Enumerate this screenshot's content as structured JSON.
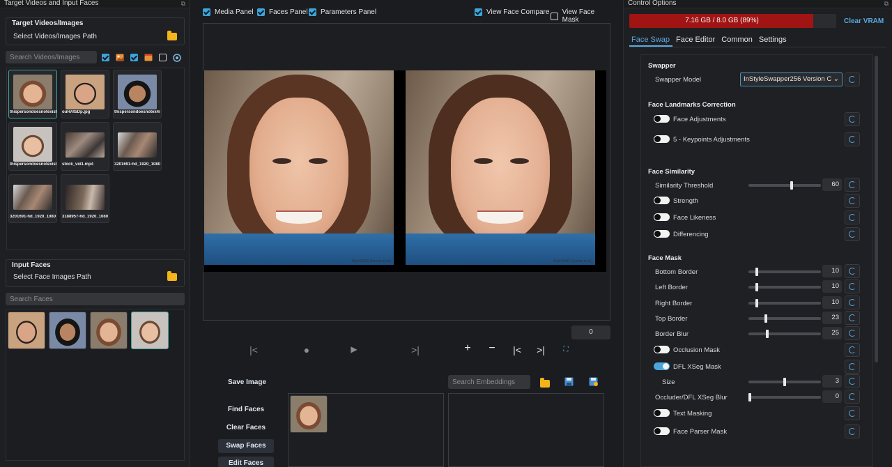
{
  "left_panel": {
    "title": "Target Videos and Input Faces",
    "target_group_title": "Target Videos/Images",
    "target_path_label": "Select Videos/Images Path",
    "search_videos_placeholder": "Search Videos/Images",
    "thumbnails": [
      {
        "caption": "thispersondoesnotexist",
        "kind": "face"
      },
      {
        "caption": "ouHAtbDp.jpg",
        "kind": "face"
      },
      {
        "caption": "thispersondoesnotex4i",
        "kind": "face"
      },
      {
        "caption": "thispersondoesnotexist",
        "kind": "face"
      },
      {
        "caption": "stock_vid1.mp4",
        "kind": "video"
      },
      {
        "caption": "3201691-hd_1920_1080",
        "kind": "video"
      },
      {
        "caption": "3201691-hd_1920_1080",
        "kind": "video"
      },
      {
        "caption": "3188957-hd_1920_1080",
        "kind": "video"
      }
    ],
    "input_faces_title": "Input Faces",
    "face_path_label": "Select Face Images Path",
    "search_faces_placeholder": "Search Faces"
  },
  "center": {
    "toggles": [
      {
        "label": "Media Panel",
        "checked": true
      },
      {
        "label": "Faces Panel",
        "checked": true
      },
      {
        "label": "Parameters Panel",
        "checked": true
      },
      {
        "label": "View Face Compare",
        "checked": true
      },
      {
        "label": "View Face Mask",
        "checked": false
      }
    ],
    "watermark": "StyleGAN2 (Karras et al.)",
    "frame_number": "0",
    "save_image_label": "Save Image",
    "search_embeddings_placeholder": "Search Embeddings",
    "buttons": {
      "find": "Find Faces",
      "clear": "Clear Faces",
      "swap": "Swap Faces",
      "edit": "Edit Faces"
    }
  },
  "right_panel": {
    "title": "Control Options",
    "vram_text": "7.16 GB / 8.0 GB (89%)",
    "vram_fraction": 0.89,
    "clear_vram": "Clear VRAM",
    "tabs": [
      "Face Swap",
      "Face Editor",
      "Common",
      "Settings"
    ],
    "active_tab": "Face Swap",
    "sections": {
      "swapper": "Swapper",
      "landmarks": "Face Landmarks Correction",
      "similarity": "Face Similarity",
      "mask": "Face Mask"
    },
    "swapper_model_label": "Swapper Model",
    "swapper_model_value": "InStyleSwapper256 Version C",
    "face_adjustments": "Face Adjustments",
    "keypoints_adjustments": "5 - Keypoints Adjustments",
    "similarity_threshold": {
      "label": "Similarity Threshold",
      "value": "60",
      "fraction": 0.6
    },
    "strength": "Strength",
    "face_likeness": "Face Likeness",
    "differencing": "Differencing",
    "bottom_border": {
      "label": "Bottom Border",
      "value": "10",
      "fraction": 0.1
    },
    "left_border": {
      "label": "Left Border",
      "value": "10",
      "fraction": 0.1
    },
    "right_border": {
      "label": "Right Border",
      "value": "10",
      "fraction": 0.1
    },
    "top_border": {
      "label": "Top Border",
      "value": "23",
      "fraction": 0.23
    },
    "border_blur": {
      "label": "Border Blur",
      "value": "25",
      "fraction": 0.25
    },
    "occlusion_mask": "Occlusion Mask",
    "dfl_xseg_mask": "DFL XSeg Mask",
    "size": {
      "label": "Size",
      "value": "3",
      "fraction": 0.5
    },
    "occluder_blur": {
      "label": "Occluder/DFL XSeg Blur",
      "value": "0",
      "fraction": 0.0
    },
    "text_masking": "Text Masking",
    "face_parser_mask": "Face Parser Mask"
  }
}
